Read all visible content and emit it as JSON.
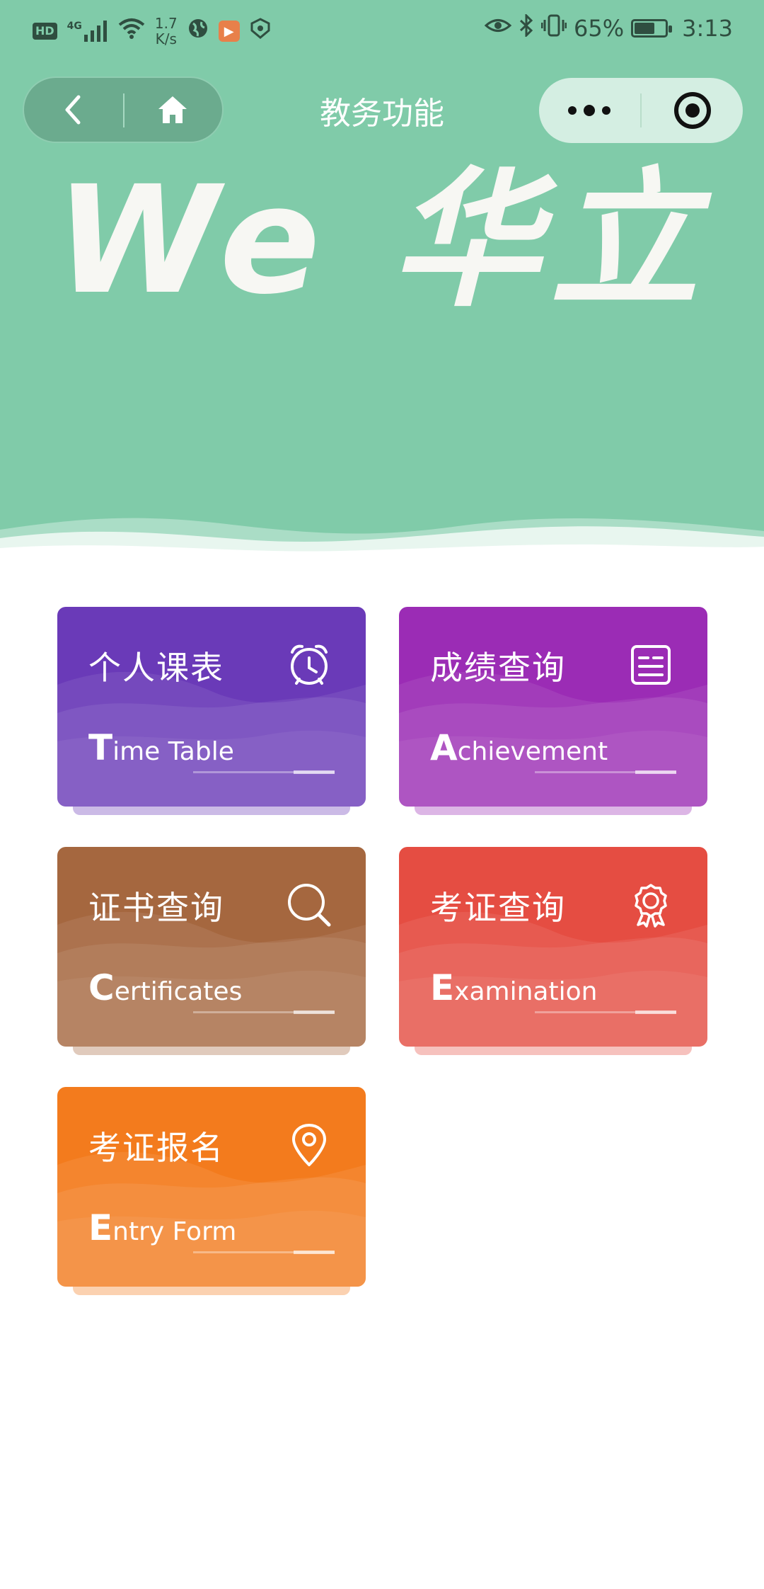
{
  "status_bar": {
    "hd": "HD",
    "network": "4G",
    "speed_value": "1.7",
    "speed_unit": "K/s",
    "battery_pct": "65%",
    "time": "3:13"
  },
  "nav": {
    "title": "教务功能"
  },
  "hero": {
    "logo_text": "We 华立"
  },
  "cards": [
    {
      "title": "个人课表",
      "sub_first": "T",
      "sub_rest": "ime Table",
      "icon": "alarm-clock-icon",
      "color": "#6a3ab8"
    },
    {
      "title": "成绩查询",
      "sub_first": "A",
      "sub_rest": "chievement",
      "icon": "document-list-icon",
      "color": "#9b2cb5"
    },
    {
      "title": "证书查询",
      "sub_first": "C",
      "sub_rest": "ertificates",
      "icon": "search-icon",
      "color": "#a5673f"
    },
    {
      "title": "考证查询",
      "sub_first": "E",
      "sub_rest": "xamination",
      "icon": "award-ribbon-icon",
      "color": "#e54d42"
    },
    {
      "title": "考证报名",
      "sub_first": "E",
      "sub_rest": "ntry Form",
      "icon": "location-pin-icon",
      "color": "#f37b1d"
    }
  ],
  "colors": {
    "header_green": "#80cba9",
    "background": "#ffffff"
  }
}
